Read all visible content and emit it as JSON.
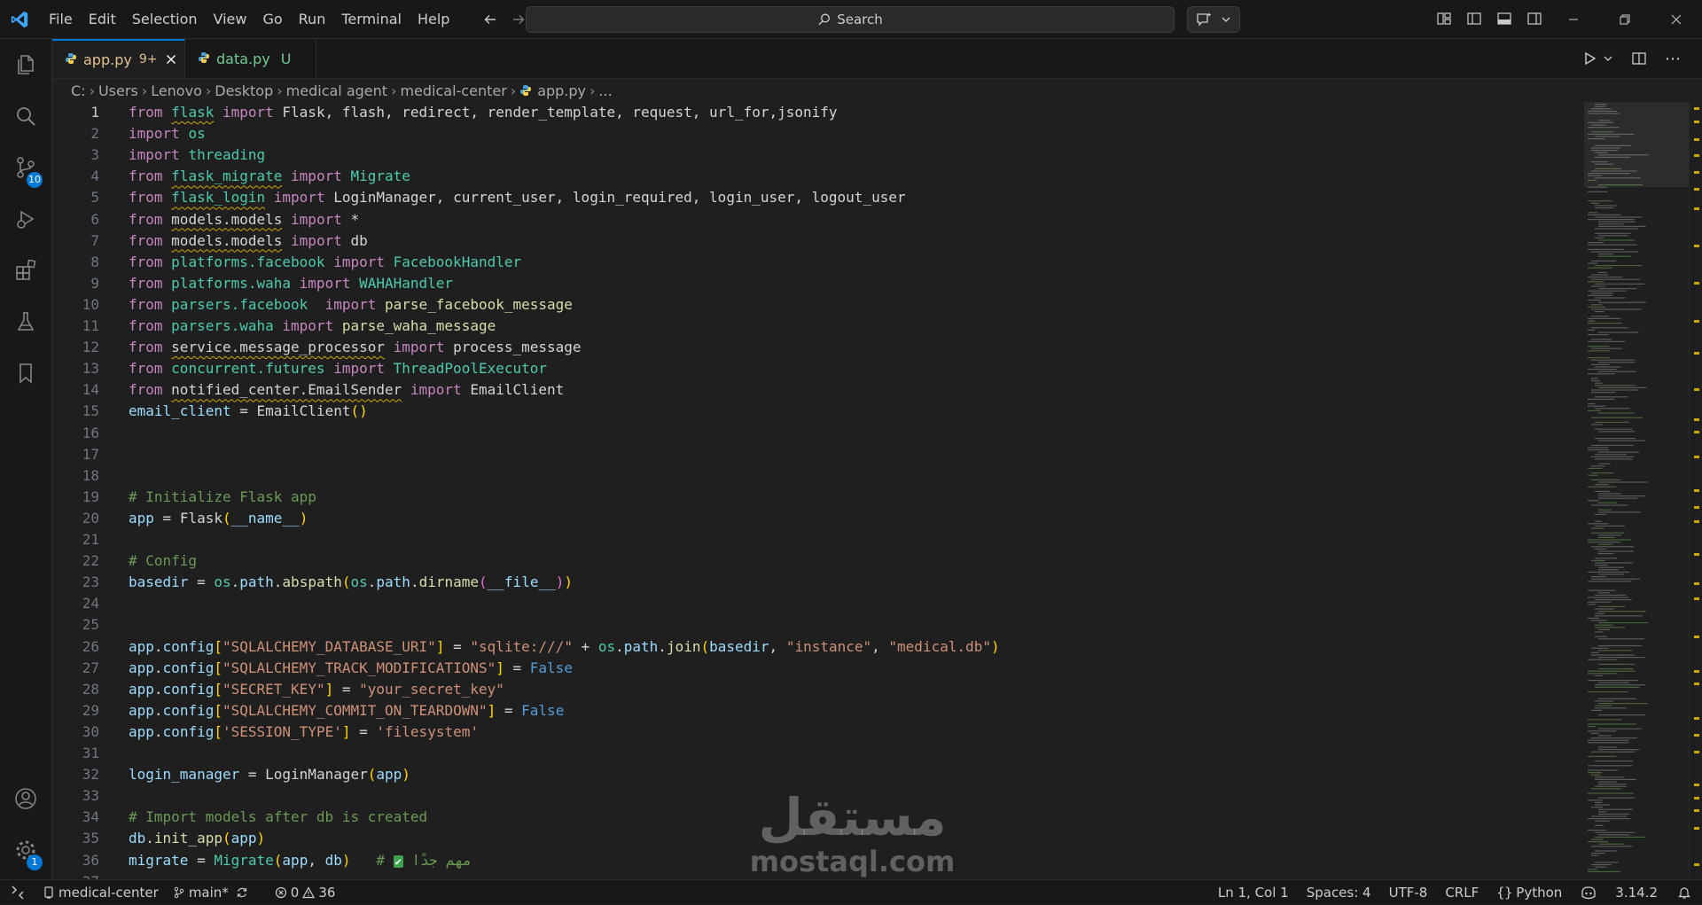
{
  "menu": [
    "File",
    "Edit",
    "Selection",
    "View",
    "Go",
    "Run",
    "Terminal",
    "Help"
  ],
  "search": {
    "label": "Search"
  },
  "activity_bar": {
    "source_control_badge": "10",
    "settings_badge": "1"
  },
  "tabs": [
    {
      "name": "app.py",
      "badge": "9+",
      "active": true
    },
    {
      "name": "data.py",
      "status": "U",
      "active": false
    }
  ],
  "breadcrumb": [
    "C:",
    "Users",
    "Lenovo",
    "Desktop",
    "medical agent",
    "medical-center",
    "app.py",
    "..."
  ],
  "code_lines": [
    {
      "n": "1",
      "t": [
        [
          "kw",
          "from "
        ],
        [
          "mod squig",
          "flask"
        ],
        [
          "kw",
          " import "
        ],
        [
          "plain",
          "Flask, flash, redirect, render_template, request, url_for,jsonify"
        ]
      ]
    },
    {
      "n": "2",
      "t": [
        [
          "kw",
          "import "
        ],
        [
          "mod",
          "os"
        ]
      ]
    },
    {
      "n": "3",
      "t": [
        [
          "kw",
          "import "
        ],
        [
          "mod",
          "threading"
        ]
      ]
    },
    {
      "n": "4",
      "t": [
        [
          "kw",
          "from "
        ],
        [
          "mod squig",
          "flask_migrate"
        ],
        [
          "kw",
          " import "
        ],
        [
          "mod",
          "Migrate"
        ]
      ]
    },
    {
      "n": "5",
      "t": [
        [
          "kw",
          "from "
        ],
        [
          "mod squig",
          "flask_login"
        ],
        [
          "kw",
          " import "
        ],
        [
          "plain",
          "LoginManager, current_user, login_required, login_user, logout_user"
        ]
      ]
    },
    {
      "n": "6",
      "t": [
        [
          "kw",
          "from "
        ],
        [
          "plain squig",
          "models.models"
        ],
        [
          "kw",
          " import "
        ],
        [
          "plain",
          "*"
        ]
      ]
    },
    {
      "n": "7",
      "t": [
        [
          "kw",
          "from "
        ],
        [
          "plain squig",
          "models.models"
        ],
        [
          "kw",
          " import "
        ],
        [
          "plain",
          "db"
        ]
      ]
    },
    {
      "n": "8",
      "t": [
        [
          "kw",
          "from "
        ],
        [
          "mod",
          "platforms.facebook"
        ],
        [
          "kw",
          " import "
        ],
        [
          "mod",
          "FacebookHandler"
        ]
      ]
    },
    {
      "n": "9",
      "t": [
        [
          "kw",
          "from "
        ],
        [
          "mod",
          "platforms.waha"
        ],
        [
          "kw",
          " import "
        ],
        [
          "mod",
          "WAHAHandler"
        ]
      ]
    },
    {
      "n": "10",
      "t": [
        [
          "kw",
          "from "
        ],
        [
          "mod",
          "parsers.facebook"
        ],
        [
          "kw",
          "  import "
        ],
        [
          "fn",
          "parse_facebook_message"
        ]
      ]
    },
    {
      "n": "11",
      "t": [
        [
          "kw",
          "from "
        ],
        [
          "mod",
          "parsers.waha"
        ],
        [
          "kw",
          " import "
        ],
        [
          "fn",
          "parse_waha_message"
        ]
      ]
    },
    {
      "n": "12",
      "t": [
        [
          "kw",
          "from "
        ],
        [
          "plain squig",
          "service.message_processor"
        ],
        [
          "kw",
          " import "
        ],
        [
          "plain",
          "process_message"
        ]
      ]
    },
    {
      "n": "13",
      "t": [
        [
          "kw",
          "from "
        ],
        [
          "mod",
          "concurrent.futures"
        ],
        [
          "kw",
          " import "
        ],
        [
          "mod",
          "ThreadPoolExecutor"
        ]
      ]
    },
    {
      "n": "14",
      "t": [
        [
          "kw",
          "from "
        ],
        [
          "plain squig",
          "notified_center.EmailSender"
        ],
        [
          "kw",
          " import "
        ],
        [
          "plain",
          "EmailClient"
        ]
      ]
    },
    {
      "n": "15",
      "t": [
        [
          "var",
          "email_client"
        ],
        [
          "plain",
          " = "
        ],
        [
          "plain",
          "EmailClient"
        ],
        [
          "br1",
          "()"
        ]
      ]
    },
    {
      "n": "16",
      "t": []
    },
    {
      "n": "17",
      "t": []
    },
    {
      "n": "18",
      "t": []
    },
    {
      "n": "19",
      "t": [
        [
          "com",
          "# Initialize Flask app"
        ]
      ]
    },
    {
      "n": "20",
      "t": [
        [
          "var",
          "app"
        ],
        [
          "plain",
          " = "
        ],
        [
          "plain",
          "Flask"
        ],
        [
          "br1",
          "("
        ],
        [
          "var",
          "__name__"
        ],
        [
          "br1",
          ")"
        ]
      ]
    },
    {
      "n": "21",
      "t": []
    },
    {
      "n": "22",
      "t": [
        [
          "com",
          "# Config"
        ]
      ]
    },
    {
      "n": "23",
      "t": [
        [
          "var",
          "basedir"
        ],
        [
          "plain",
          " = "
        ],
        [
          "mod",
          "os"
        ],
        [
          "plain",
          "."
        ],
        [
          "var",
          "path"
        ],
        [
          "plain",
          "."
        ],
        [
          "fn",
          "abspath"
        ],
        [
          "br1",
          "("
        ],
        [
          "mod",
          "os"
        ],
        [
          "plain",
          "."
        ],
        [
          "var",
          "path"
        ],
        [
          "plain",
          "."
        ],
        [
          "fn",
          "dirname"
        ],
        [
          "br2",
          "("
        ],
        [
          "var",
          "__file__"
        ],
        [
          "br2",
          ")"
        ],
        [
          "br1",
          ")"
        ]
      ]
    },
    {
      "n": "24",
      "t": []
    },
    {
      "n": "25",
      "t": []
    },
    {
      "n": "26",
      "t": [
        [
          "var",
          "app"
        ],
        [
          "plain",
          "."
        ],
        [
          "var",
          "config"
        ],
        [
          "br1",
          "["
        ],
        [
          "str",
          "\"SQLALCHEMY_DATABASE_URI\""
        ],
        [
          "br1",
          "]"
        ],
        [
          "plain",
          " = "
        ],
        [
          "str",
          "\"sqlite:///\""
        ],
        [
          "plain",
          " + "
        ],
        [
          "mod",
          "os"
        ],
        [
          "plain",
          "."
        ],
        [
          "var",
          "path"
        ],
        [
          "plain",
          "."
        ],
        [
          "fn",
          "join"
        ],
        [
          "br1",
          "("
        ],
        [
          "var",
          "basedir"
        ],
        [
          "plain",
          ", "
        ],
        [
          "str",
          "\"instance\""
        ],
        [
          "plain",
          ", "
        ],
        [
          "str",
          "\"medical.db\""
        ],
        [
          "br1",
          ")"
        ]
      ]
    },
    {
      "n": "27",
      "t": [
        [
          "var",
          "app"
        ],
        [
          "plain",
          "."
        ],
        [
          "var",
          "config"
        ],
        [
          "br1",
          "["
        ],
        [
          "str",
          "\"SQLALCHEMY_TRACK_MODIFICATIONS\""
        ],
        [
          "br1",
          "]"
        ],
        [
          "plain",
          " = "
        ],
        [
          "const",
          "False"
        ]
      ]
    },
    {
      "n": "28",
      "t": [
        [
          "var",
          "app"
        ],
        [
          "plain",
          "."
        ],
        [
          "var",
          "config"
        ],
        [
          "br1",
          "["
        ],
        [
          "str",
          "\"SECRET_KEY\""
        ],
        [
          "br1",
          "]"
        ],
        [
          "plain",
          " = "
        ],
        [
          "str",
          "\"your_secret_key\""
        ]
      ]
    },
    {
      "n": "29",
      "t": [
        [
          "var",
          "app"
        ],
        [
          "plain",
          "."
        ],
        [
          "var",
          "config"
        ],
        [
          "br1",
          "["
        ],
        [
          "str",
          "\"SQLALCHEMY_COMMIT_ON_TEARDOWN\""
        ],
        [
          "br1",
          "]"
        ],
        [
          "plain",
          " = "
        ],
        [
          "const",
          "False"
        ]
      ]
    },
    {
      "n": "30",
      "t": [
        [
          "var",
          "app"
        ],
        [
          "plain",
          "."
        ],
        [
          "var",
          "config"
        ],
        [
          "br1",
          "["
        ],
        [
          "str",
          "'SESSION_TYPE'"
        ],
        [
          "br1",
          "]"
        ],
        [
          "plain",
          " = "
        ],
        [
          "str",
          "'filesystem'"
        ]
      ]
    },
    {
      "n": "31",
      "t": []
    },
    {
      "n": "32",
      "t": [
        [
          "var",
          "login_manager"
        ],
        [
          "plain",
          " = "
        ],
        [
          "plain",
          "LoginManager"
        ],
        [
          "br1",
          "("
        ],
        [
          "var",
          "app"
        ],
        [
          "br1",
          ")"
        ]
      ]
    },
    {
      "n": "33",
      "t": []
    },
    {
      "n": "34",
      "t": [
        [
          "com",
          "# Import models after db is created"
        ]
      ]
    },
    {
      "n": "35",
      "t": [
        [
          "var",
          "db"
        ],
        [
          "plain",
          "."
        ],
        [
          "fn",
          "init_app"
        ],
        [
          "br1",
          "("
        ],
        [
          "var",
          "app"
        ],
        [
          "br1",
          ")"
        ]
      ]
    },
    {
      "n": "36",
      "t": [
        [
          "var",
          "migrate"
        ],
        [
          "plain",
          " = "
        ],
        [
          "mod",
          "Migrate"
        ],
        [
          "br1",
          "("
        ],
        [
          "var",
          "app"
        ],
        [
          "plain",
          ", "
        ],
        [
          "var",
          "db"
        ],
        [
          "br1",
          ")"
        ],
        [
          "plain",
          "   "
        ],
        [
          "com",
          "# "
        ],
        [
          "check",
          "✔"
        ],
        [
          "arabic",
          " مهم جدًا"
        ]
      ]
    },
    {
      "n": "37",
      "t": []
    }
  ],
  "watermark": {
    "arabic": "مستقل",
    "latin": "mostaql.com"
  },
  "statusbar": {
    "folder": "medical-center",
    "branch": "main*",
    "errors": "0",
    "warnings": "36",
    "position": "Ln 1, Col 1",
    "spaces": "Spaces: 4",
    "encoding": "UTF-8",
    "eol": "CRLF",
    "language": "Python",
    "version": "3.14.2"
  },
  "colors": {
    "accent": "#0078d4",
    "warning": "#cca700",
    "untracked": "#73c991",
    "modified": "#e2c08d"
  }
}
